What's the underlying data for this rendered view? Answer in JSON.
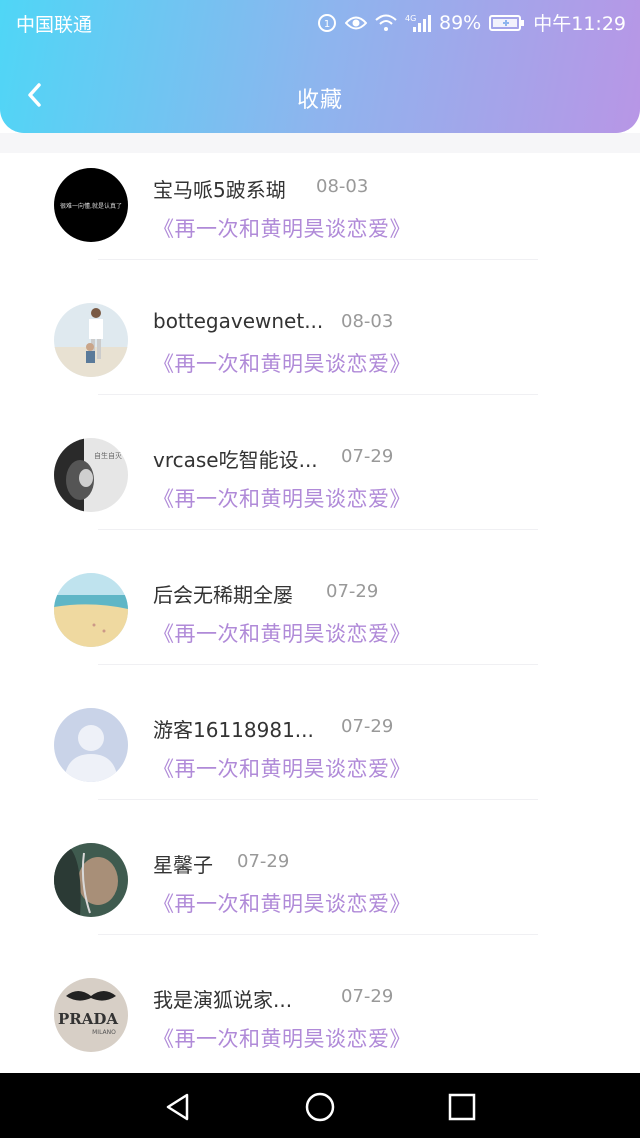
{
  "status": {
    "carrier": "中国联通",
    "network": "4G",
    "battery": "89%",
    "time": "中午11:29"
  },
  "header": {
    "title": "收藏",
    "back_icon": "chevron-left-icon"
  },
  "items": [
    {
      "name": "宝马哌5跛系瑚",
      "date": "08-03",
      "work": "《再一次和黄明昊谈恋爱》",
      "avatar_text": "很难一向懂,就是认真了"
    },
    {
      "name": "bottegavewnet...",
      "date": "08-03",
      "work": "《再一次和黄明昊谈恋爱》"
    },
    {
      "name": "vrcase吃智能设...",
      "date": "07-29",
      "work": "《再一次和黄明昊谈恋爱》",
      "avatar_text": "自生自灭"
    },
    {
      "name": "后会无稀期全屡",
      "date": "07-29",
      "work": "《再一次和黄明昊谈恋爱》"
    },
    {
      "name": "游客16118981...",
      "date": "07-29",
      "work": "《再一次和黄明昊谈恋爱》"
    },
    {
      "name": "星馨子",
      "date": "07-29",
      "work": "《再一次和黄明昊谈恋爱》"
    },
    {
      "name": "我是演狐说家...",
      "date": "07-29",
      "work": "《再一次和黄明昊谈恋爱》",
      "avatar_text": "PRADA",
      "avatar_subtext": "MILANO"
    }
  ],
  "navbar": {
    "back": "nav-back-icon",
    "home": "nav-home-icon",
    "recents": "nav-recents-icon"
  },
  "colors": {
    "gradient_start": "#4fd6f6",
    "gradient_end": "#b896e6",
    "work_title": "#b08ad8"
  }
}
